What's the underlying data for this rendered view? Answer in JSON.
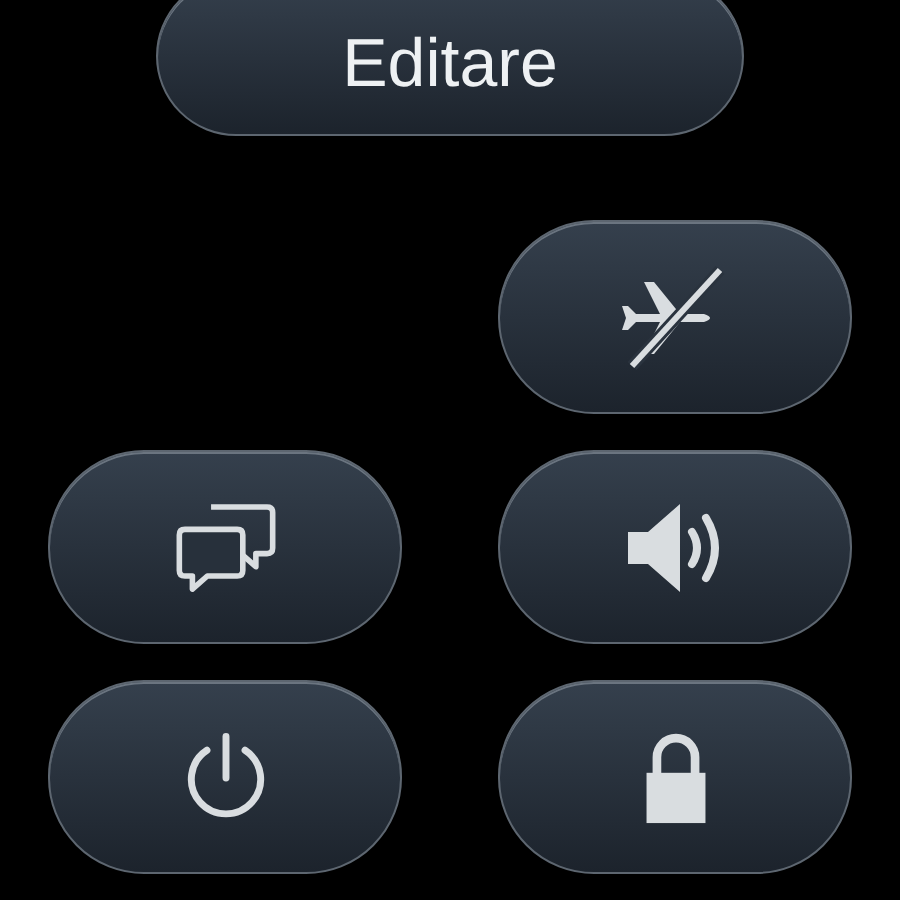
{
  "edit_button": {
    "label": "Editare"
  },
  "tiles": [
    {
      "kind": "airplane_off"
    },
    {
      "kind": "messages"
    },
    {
      "kind": "sound"
    },
    {
      "kind": "power"
    },
    {
      "kind": "lock"
    }
  ]
}
